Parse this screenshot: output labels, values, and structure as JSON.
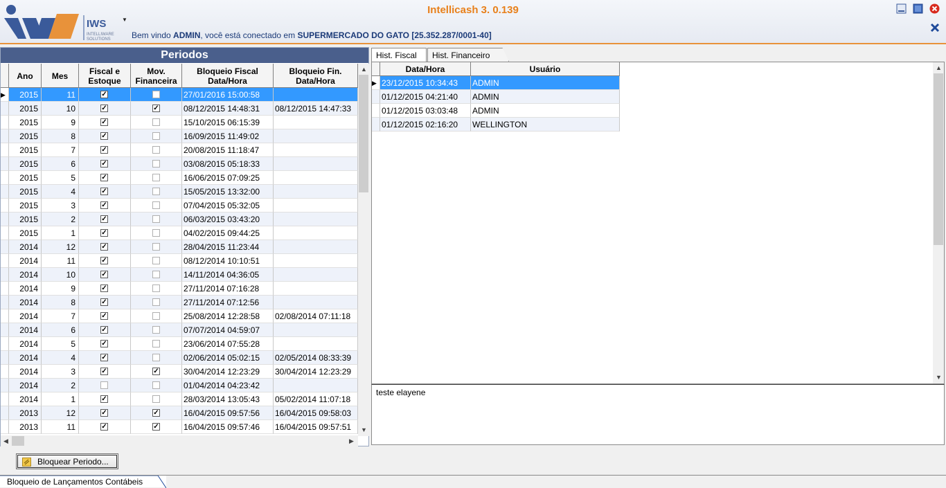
{
  "app": {
    "title": "Intellicash 3. 0.139",
    "logo_text": "IWS",
    "logo_sub1": "INTELLIWARE",
    "logo_sub2": "SOLUTIONS",
    "welcome_prefix": "Bem vindo ",
    "user": "ADMIN",
    "welcome_mid": ", você está conectado em ",
    "company": "SUPERMERCADO DO GATO [25.352.287/0001-40]",
    "accent": "#e8801a",
    "brand_blue": "#1b3a78"
  },
  "periodos": {
    "title": "Periodos",
    "columns": [
      "Ano",
      "Mes",
      "Fiscal e\nEstoque",
      "Mov.\nFinanceira",
      "Bloqueio Fiscal\nData/Hora",
      "Bloqueio Fin.\nData/Hora"
    ],
    "rows": [
      {
        "ano": "2015",
        "mes": "11",
        "fiscal": true,
        "fin": false,
        "bf": "27/01/2016 15:00:58",
        "bfin": ""
      },
      {
        "ano": "2015",
        "mes": "10",
        "fiscal": true,
        "fin": true,
        "bf": "08/12/2015 14:48:31",
        "bfin": "08/12/2015 14:47:33"
      },
      {
        "ano": "2015",
        "mes": "9",
        "fiscal": true,
        "fin": false,
        "bf": "15/10/2015 06:15:39",
        "bfin": ""
      },
      {
        "ano": "2015",
        "mes": "8",
        "fiscal": true,
        "fin": false,
        "bf": "16/09/2015 11:49:02",
        "bfin": ""
      },
      {
        "ano": "2015",
        "mes": "7",
        "fiscal": true,
        "fin": false,
        "bf": "20/08/2015 11:18:47",
        "bfin": ""
      },
      {
        "ano": "2015",
        "mes": "6",
        "fiscal": true,
        "fin": false,
        "bf": "03/08/2015 05:18:33",
        "bfin": ""
      },
      {
        "ano": "2015",
        "mes": "5",
        "fiscal": true,
        "fin": false,
        "bf": "16/06/2015 07:09:25",
        "bfin": ""
      },
      {
        "ano": "2015",
        "mes": "4",
        "fiscal": true,
        "fin": false,
        "bf": "15/05/2015 13:32:00",
        "bfin": ""
      },
      {
        "ano": "2015",
        "mes": "3",
        "fiscal": true,
        "fin": false,
        "bf": "07/04/2015 05:32:05",
        "bfin": ""
      },
      {
        "ano": "2015",
        "mes": "2",
        "fiscal": true,
        "fin": false,
        "bf": "06/03/2015 03:43:20",
        "bfin": ""
      },
      {
        "ano": "2015",
        "mes": "1",
        "fiscal": true,
        "fin": false,
        "bf": "04/02/2015 09:44:25",
        "bfin": ""
      },
      {
        "ano": "2014",
        "mes": "12",
        "fiscal": true,
        "fin": false,
        "bf": "28/04/2015 11:23:44",
        "bfin": ""
      },
      {
        "ano": "2014",
        "mes": "11",
        "fiscal": true,
        "fin": false,
        "bf": "08/12/2014 10:10:51",
        "bfin": ""
      },
      {
        "ano": "2014",
        "mes": "10",
        "fiscal": true,
        "fin": false,
        "bf": "14/11/2014 04:36:05",
        "bfin": ""
      },
      {
        "ano": "2014",
        "mes": "9",
        "fiscal": true,
        "fin": false,
        "bf": "27/11/2014 07:16:28",
        "bfin": ""
      },
      {
        "ano": "2014",
        "mes": "8",
        "fiscal": true,
        "fin": false,
        "bf": "27/11/2014 07:12:56",
        "bfin": ""
      },
      {
        "ano": "2014",
        "mes": "7",
        "fiscal": true,
        "fin": false,
        "bf": "25/08/2014 12:28:58",
        "bfin": "02/08/2014 07:11:18"
      },
      {
        "ano": "2014",
        "mes": "6",
        "fiscal": true,
        "fin": false,
        "bf": "07/07/2014 04:59:07",
        "bfin": ""
      },
      {
        "ano": "2014",
        "mes": "5",
        "fiscal": true,
        "fin": false,
        "bf": "23/06/2014 07:55:28",
        "bfin": ""
      },
      {
        "ano": "2014",
        "mes": "4",
        "fiscal": true,
        "fin": false,
        "bf": "02/06/2014 05:02:15",
        "bfin": "02/05/2014 08:33:39"
      },
      {
        "ano": "2014",
        "mes": "3",
        "fiscal": true,
        "fin": true,
        "bf": "30/04/2014 12:23:29",
        "bfin": "30/04/2014 12:23:29"
      },
      {
        "ano": "2014",
        "mes": "2",
        "fiscal": false,
        "fin": false,
        "bf": "01/04/2014 04:23:42",
        "bfin": ""
      },
      {
        "ano": "2014",
        "mes": "1",
        "fiscal": true,
        "fin": false,
        "bf": "28/03/2014 13:05:43",
        "bfin": "05/02/2014 11:07:18"
      },
      {
        "ano": "2013",
        "mes": "12",
        "fiscal": true,
        "fin": true,
        "bf": "16/04/2015 09:57:56",
        "bfin": "16/04/2015 09:58:03"
      },
      {
        "ano": "2013",
        "mes": "11",
        "fiscal": true,
        "fin": true,
        "bf": "16/04/2015 09:57:46",
        "bfin": "16/04/2015 09:57:51"
      }
    ]
  },
  "tabs": {
    "fiscal": "Hist. Fiscal",
    "financeiro": "Hist. Financeiro"
  },
  "historico": {
    "columns": [
      "Data/Hora",
      "Usuário"
    ],
    "rows": [
      {
        "dt": "23/12/2015 10:34:43",
        "user": "ADMIN"
      },
      {
        "dt": "01/12/2015 04:21:40",
        "user": "ADMIN"
      },
      {
        "dt": "01/12/2015 03:03:48",
        "user": "ADMIN"
      },
      {
        "dt": "01/12/2015 02:16:20",
        "user": "WELLINGTON"
      }
    ]
  },
  "notes": "teste elayene",
  "buttons": {
    "bloquear": "Bloquear Periodo..."
  },
  "bottom_tab": "Bloqueio de Lançamentos Contábeis"
}
